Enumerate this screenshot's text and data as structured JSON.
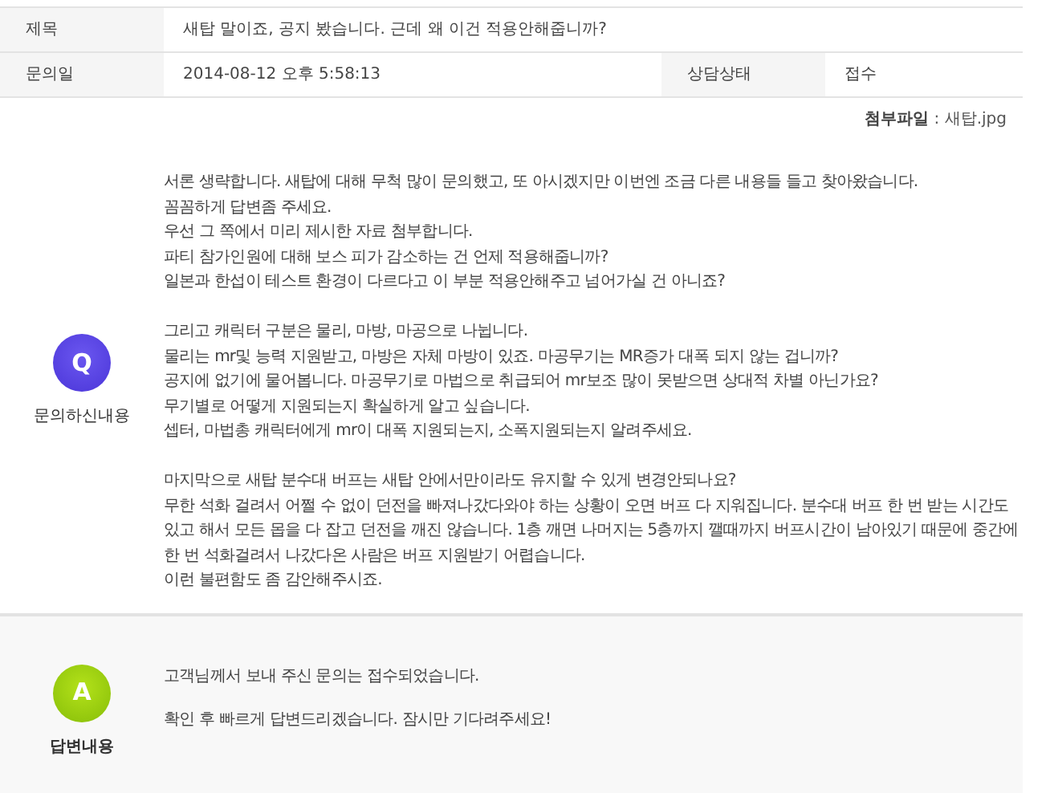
{
  "info_rows": [
    [
      {
        "label": "제목",
        "value": "새탑 말이죠, 공지 봤습니다. 근데 왜 이건 적용안해줍니까?"
      }
    ],
    [
      {
        "label": "문의일",
        "value": "2014-08-12 오후 5:58:13"
      },
      {
        "label": "상담상태",
        "value": "접수"
      }
    ]
  ],
  "attachment": "**첨부파일** : 새탑.jpg",
  "sections": [
    {
      "kind": "question",
      "badge": "Q",
      "caption": "문의하신내용",
      "paragraphs": [
        [
          "서론 생략합니다. 새탑에 대해 무척 많이 문의했고, 또 아시겠지만 이번엔 조금 다른 내용들 들고 찾아왔습니다.",
          "꼼꼼하게 답변좀 주세요.",
          "우선 그 쪽에서 미리 제시한 자료 첨부합니다.",
          "파티 참가인원에 대해 보스 피가 감소하는 건 언제 적용해줍니까?",
          "일본과 한섭이 테스트 환경이 다르다고 이 부분 적용안해주고 넘어가실 건 아니죠?"
        ],
        [
          "그리고 캐릭터 구분은 물리, 마방, 마공으로 나뉩니다.",
          "물리는 mr및 능력 지원받고, 마방은 자체 마방이 있죠. 마공무기는 MR증가 대폭 되지 않는 겁니까?",
          "공지에 없기에 물어봅니다. 마공무기로 마법으로 취급되어 mr보조 많이 못받으면 상대적 차별 아닌가요?",
          "무기별로 어떻게 지원되는지 확실하게 알고 싶습니다.",
          "셉터, 마법총 캐릭터에게 mr이 대폭 지원되는지, 소폭지원되는지 알려주세요."
        ],
        [
          "마지막으로 새탑 분수대 버프는 새탑 안에서만이라도 유지할 수 있게 변경안되나요?",
          "무한 석화 걸려서 어쩔 수 없이 던전을 빠져나갔다와야 하는 상황이 오면 버프 다 지워집니다. 분수대 버프 한 번 받는 시간도 있고 해서 모든 몹을 다 잡고 던전을 깨진 않습니다. 1층 깨면 나머지는 5층까지 깰때까지 버프시간이 남아있기 때문에 중간에 한 번 석화걸려서 나갔다온 사람은 버프 지원받기 어렵습니다.",
          "이런 불편함도 좀 감안해주시죠."
        ]
      ]
    },
    {
      "kind": "answer",
      "badge": "A",
      "caption": "답변내용",
      "paragraphs": [
        [
          "고객님께서 보내 주신 문의는 접수되었습니다."
        ],
        [
          "확인 후 빠르게 답변드리겠습니다. 잠시만 기다려주세요!"
        ]
      ]
    }
  ]
}
